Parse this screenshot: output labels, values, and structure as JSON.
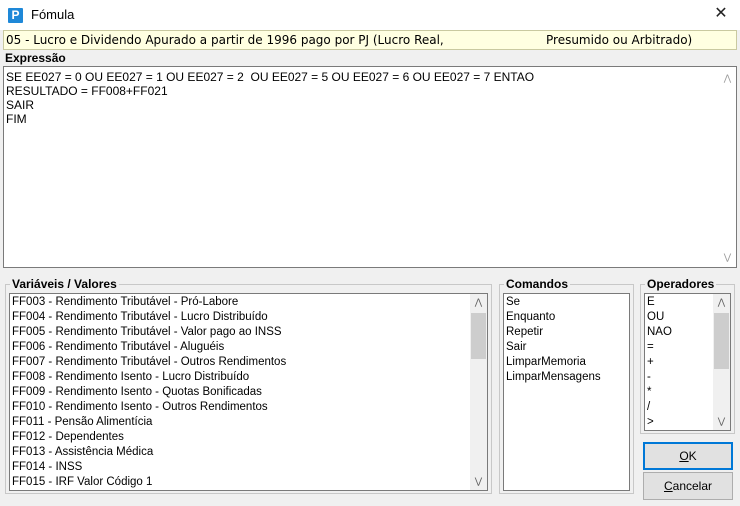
{
  "window": {
    "title": "Fómula",
    "icon_letter": "P",
    "close_symbol": "✕"
  },
  "header": {
    "text_left": "05 - Lucro e Dividendo Apurado a partir de 1996 pago por PJ (Lucro Real,",
    "text_right": "Presumido ou Arbitrado)"
  },
  "expression": {
    "label": "Expressão",
    "lines": [
      "SE EE027 = 0 OU EE027 = 1 OU EE027 = 2  OU EE027 = 5 OU EE027 = 6 OU EE027 = 7 ENTAO",
      "RESULTADO = FF008+FF021",
      "SAIR",
      "FIM"
    ]
  },
  "variables": {
    "label": "Variáveis / Valores",
    "items": [
      "FF003 - Rendimento Tributável - Pró-Labore",
      "FF004 - Rendimento Tributável - Lucro Distribuído",
      "FF005 - Rendimento Tributável - Valor pago ao INSS",
      "FF006 - Rendimento Tributável - Aluguéis",
      "FF007 - Rendimento Tributável - Outros Rendimentos",
      "FF008 - Rendimento Isento - Lucro Distribuído",
      "FF009 - Rendimento Isento - Quotas Bonificadas",
      "FF010 - Rendimento Isento - Outros Rendimentos",
      "FF011 - Pensão Alimentícia",
      "FF012 - Dependentes",
      "FF013 - Assistência Médica",
      "FF014 - INSS",
      "FF015 - IRF Valor Código 1"
    ]
  },
  "commands": {
    "label": "Comandos",
    "items": [
      "Se",
      "Enquanto",
      "Repetir",
      "Sair",
      "LimparMemoria",
      "LimparMensagens"
    ]
  },
  "operators": {
    "label": "Operadores",
    "items": [
      "E",
      "OU",
      "NAO",
      "=",
      "+",
      "-",
      "*",
      "/",
      ">"
    ]
  },
  "buttons": {
    "ok_label": "OK",
    "cancel_label": "Cancelar"
  }
}
